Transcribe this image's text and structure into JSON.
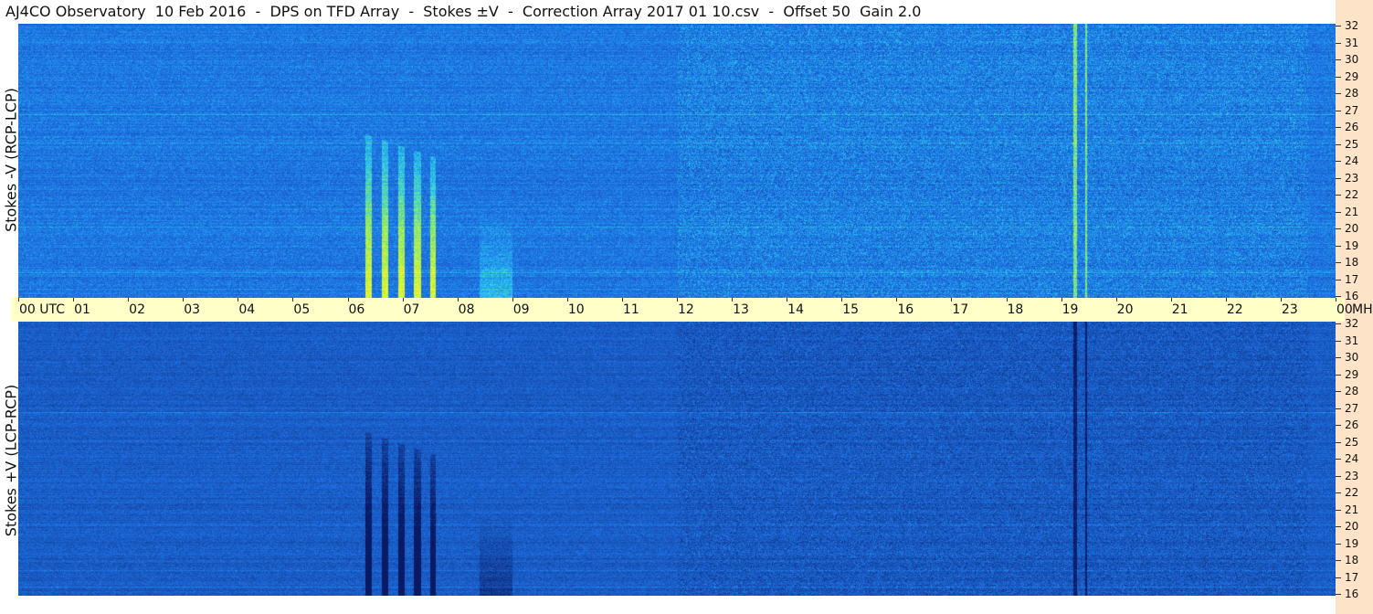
{
  "title": "AJ4CO Observatory  10 Feb 2016  -  DPS on TFD Array  -  Stokes ±V  -  Correction Array 2017 01 10.csv  -  Offset 50  Gain 2.0",
  "panels": {
    "top": {
      "ylabel": "Stokes -V (RCP-LCP)",
      "mode": "rcp-lcp"
    },
    "bottom": {
      "ylabel": "Stokes +V (LCP-RCP)",
      "mode": "lcp-rcp"
    }
  },
  "time_axis": {
    "labels": [
      "00 UTC",
      "01",
      "02",
      "03",
      "04",
      "05",
      "06",
      "07",
      "08",
      "09",
      "10",
      "11",
      "12",
      "13",
      "14",
      "15",
      "16",
      "17",
      "18",
      "19",
      "20",
      "21",
      "22",
      "23",
      "00"
    ],
    "end_unit": "MHz"
  },
  "freq_axis": {
    "labels": [
      "32",
      "31",
      "30",
      "29",
      "28",
      "27",
      "26",
      "25",
      "24",
      "23",
      "22",
      "21",
      "20",
      "19",
      "18",
      "17",
      "16"
    ],
    "min_mhz": 16,
    "max_mhz": 32
  },
  "colors": {
    "background_blue": "#1e73e6",
    "axis_bar": "#ffffc8",
    "right_strip": "#fde3c8"
  }
}
